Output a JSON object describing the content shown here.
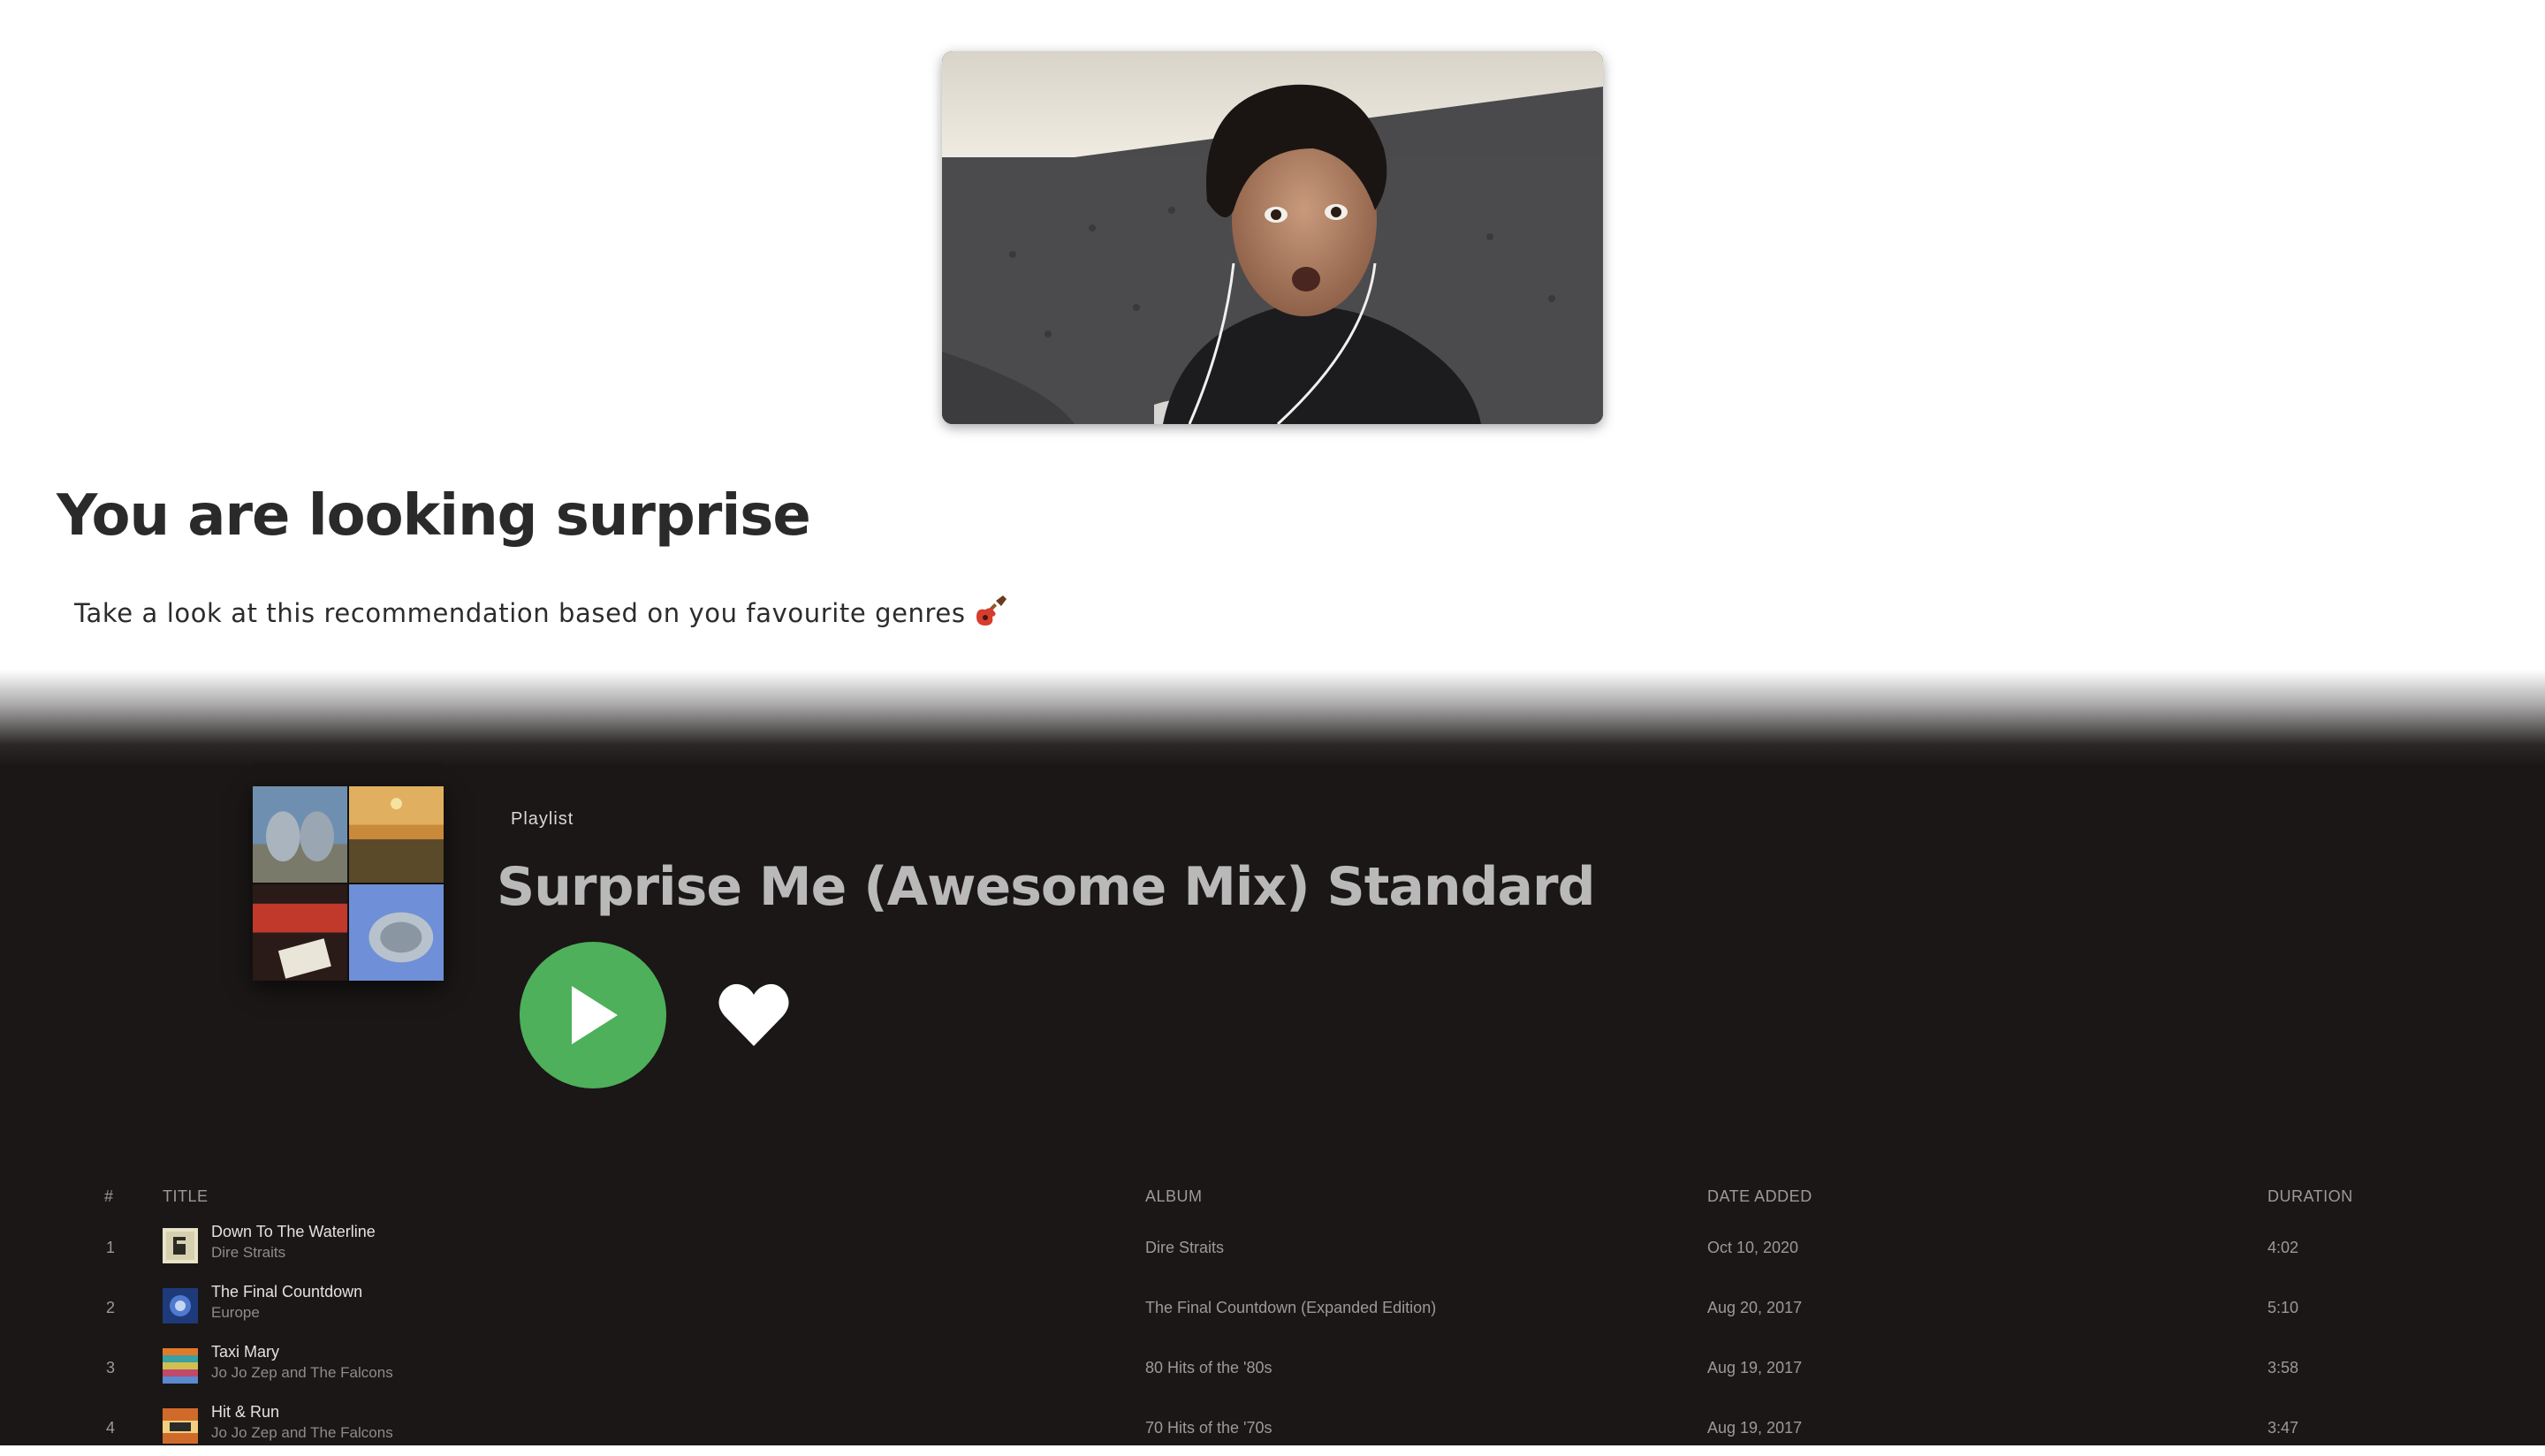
{
  "emotion": {
    "headline": "You are looking surprise",
    "subtext": "Take a look at this recommendation based on you favourite genres",
    "subtext_icon": "guitar-icon"
  },
  "playlist": {
    "type_label": "Playlist",
    "title": "Surprise Me (Awesome Mix) Standard",
    "play_icon": "play-icon",
    "like_icon": "heart-icon"
  },
  "colors": {
    "player_bg": "#1a1716",
    "play_button": "#4eb05a",
    "title_text": "#b9b9b9"
  },
  "table": {
    "headers": {
      "num": "#",
      "title": "TITLE",
      "album": "ALBUM",
      "date": "DATE ADDED",
      "duration": "DURATION"
    },
    "rows": [
      {
        "num": "1",
        "title": "Down To The Waterline",
        "artist": "Dire Straits",
        "album": "Dire Straits",
        "date": "Oct 10, 2020",
        "duration": "4:02"
      },
      {
        "num": "2",
        "title": "The Final Countdown",
        "artist": "Europe",
        "album": "The Final Countdown (Expanded Edition)",
        "date": "Aug 20, 2017",
        "duration": "5:10"
      },
      {
        "num": "3",
        "title": "Taxi Mary",
        "artist": "Jo Jo Zep and The Falcons",
        "album": "80 Hits of the '80s",
        "date": "Aug 19, 2017",
        "duration": "3:58"
      },
      {
        "num": "4",
        "title": "Hit & Run",
        "artist": "Jo Jo Zep and The Falcons",
        "album": "70 Hits of the '70s",
        "date": "Aug 19, 2017",
        "duration": "3:47"
      }
    ]
  }
}
